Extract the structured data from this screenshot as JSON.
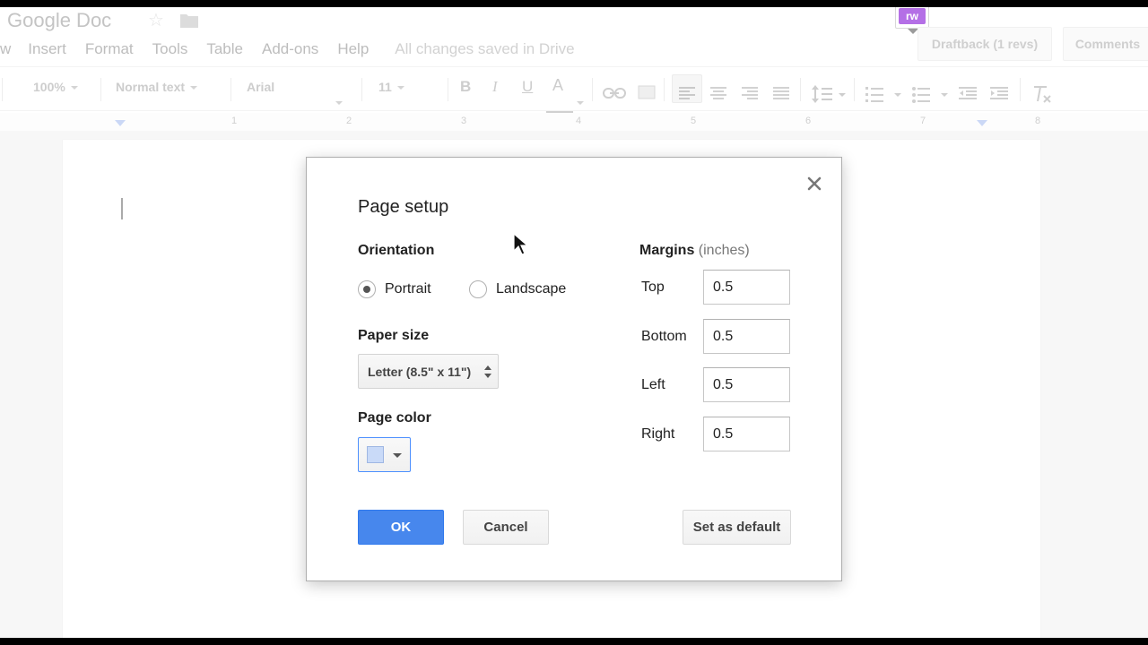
{
  "app": {
    "doc_title": "Google Doc",
    "menu": [
      "w",
      "Insert",
      "Format",
      "Tools",
      "Table",
      "Add-ons",
      "Help"
    ],
    "save_status": "All changes saved in Drive",
    "extension_badge": "rw",
    "draftback_label": "Draftback (1 revs)",
    "comments_label": "Comments"
  },
  "toolbar": {
    "zoom": "100%",
    "style": "Normal text",
    "font": "Arial",
    "font_size": "11",
    "bold": "B",
    "italic": "I",
    "underline": "U",
    "text_color": "A"
  },
  "ruler": {
    "numbers": [
      "1",
      "2",
      "3",
      "4",
      "5",
      "6",
      "7",
      "8"
    ]
  },
  "dialog": {
    "title": "Page setup",
    "orientation_label": "Orientation",
    "orientation_options": [
      {
        "label": "Portrait",
        "checked": true
      },
      {
        "label": "Landscape",
        "checked": false
      }
    ],
    "paper_size_label": "Paper size",
    "paper_size_value": "Letter (8.5\" x 11\")",
    "page_color_label": "Page color",
    "page_color_value": "#c9daf8",
    "margins_label": "Margins",
    "margins_unit": "(inches)",
    "margins": {
      "top_label": "Top",
      "top": "0.5",
      "bottom_label": "Bottom",
      "bottom": "0.5",
      "left_label": "Left",
      "left": "0.5",
      "right_label": "Right",
      "right": "0.5"
    },
    "ok_label": "OK",
    "cancel_label": "Cancel",
    "default_label": "Set as default"
  },
  "colors": {
    "primary_button": "#4787ed",
    "page_color_swatch": "#c9daf8"
  }
}
